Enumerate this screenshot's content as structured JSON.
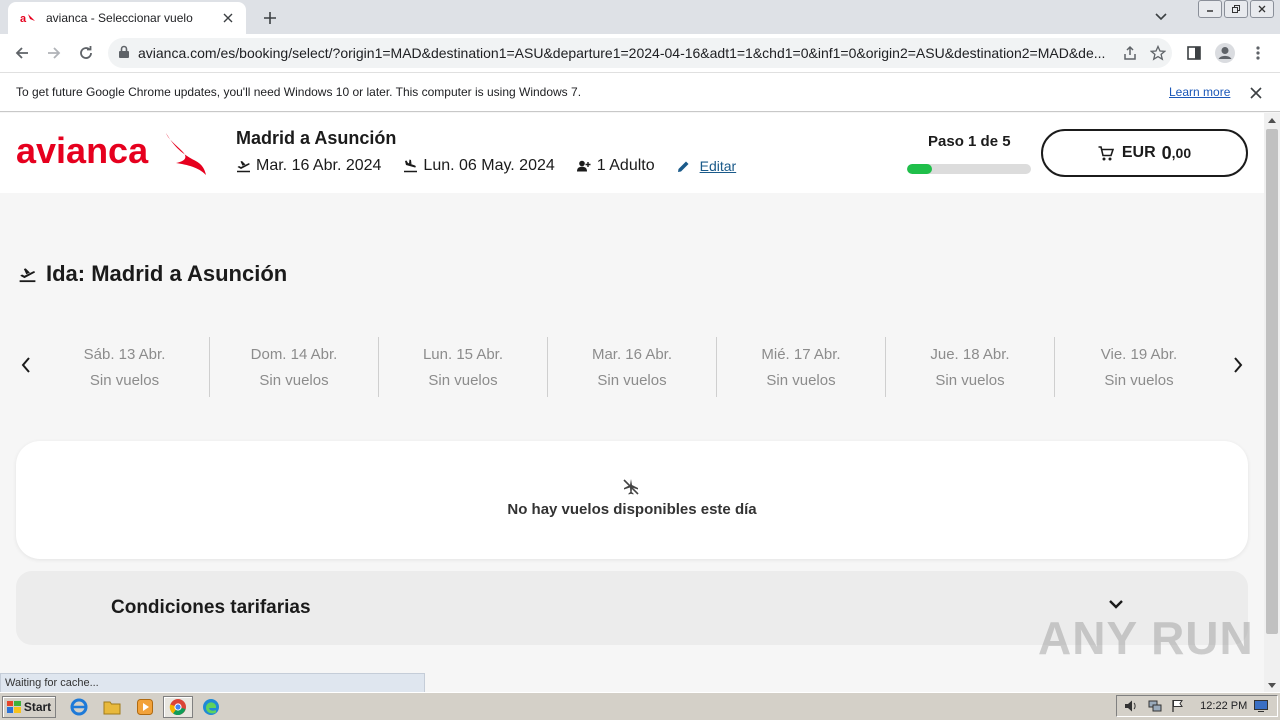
{
  "browser": {
    "tab_title": "avianca - Seleccionar vuelo",
    "url": "avianca.com/es/booking/select/?origin1=MAD&destination1=ASU&departure1=2024-04-16&adt1=1&chd1=0&inf1=0&origin2=ASU&destination2=MAD&de...",
    "infobar_text": "To get future Google Chrome updates, you'll need Windows 10 or later. This computer is using Windows 7.",
    "infobar_link": "Learn more",
    "status_text": "Waiting for cache..."
  },
  "header": {
    "logo_text": "avianca",
    "route_title": "Madrid a Asunción",
    "departure_date": "Mar. 16 Abr. 2024",
    "return_date": "Lun. 06 May. 2024",
    "passengers": "1 Adulto",
    "edit_label": "Editar",
    "step_label": "Paso 1 de 5",
    "step_progress": 0.2,
    "cart_currency": "EUR",
    "cart_amount": "0",
    "cart_cents": ",00"
  },
  "main": {
    "section_title": "Ida: Madrid a Asunción",
    "days": [
      {
        "date": "Sáb. 13 Abr.",
        "status": "Sin vuelos"
      },
      {
        "date": "Dom. 14 Abr.",
        "status": "Sin vuelos"
      },
      {
        "date": "Lun. 15 Abr.",
        "status": "Sin vuelos"
      },
      {
        "date": "Mar. 16 Abr.",
        "status": "Sin vuelos"
      },
      {
        "date": "Mié. 17 Abr.",
        "status": "Sin vuelos"
      },
      {
        "date": "Jue. 18 Abr.",
        "status": "Sin vuelos"
      },
      {
        "date": "Vie. 19 Abr.",
        "status": "Sin vuelos"
      }
    ],
    "no_flights_message": "No hay vuelos disponibles este día",
    "conditions_label": "Condiciones tarifarias"
  },
  "watermark": "ANY RUN",
  "taskbar": {
    "start_label": "Start",
    "clock": "12:22 PM"
  },
  "colors": {
    "brand_red": "#e6001e",
    "progress_green": "#1fbf4a",
    "link_blue": "#1a5a8a"
  }
}
